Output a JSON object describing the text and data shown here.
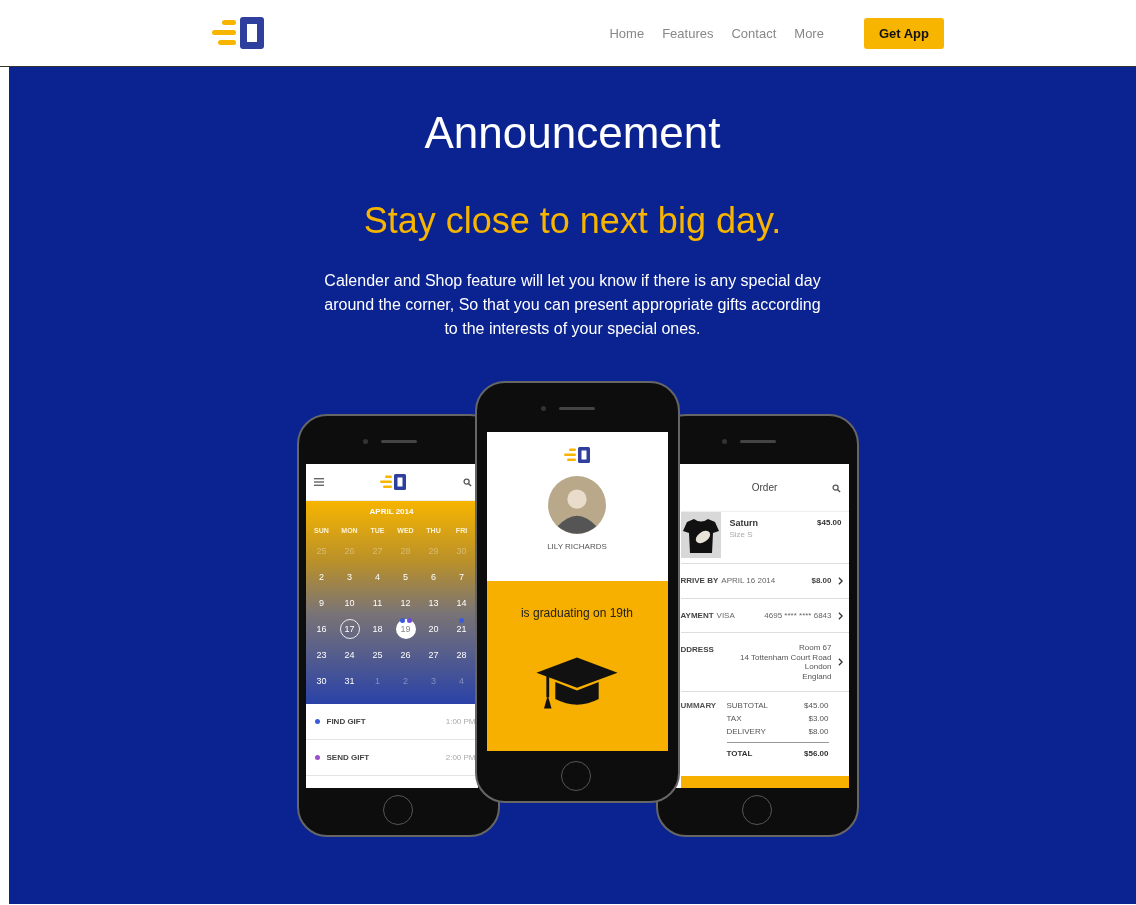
{
  "header": {
    "nav": [
      "Home",
      "Features",
      "Contact",
      "More"
    ],
    "cta": "Get App"
  },
  "hero": {
    "title": "Announcement",
    "subtitle": "Stay close to next big day.",
    "body": "Calender and Shop feature will let you know if there is any special day around the corner, So that you can present appropriate gifts according to the interests of your special ones."
  },
  "calendar_phone": {
    "month": "APRIL 2014",
    "weekdays": [
      "SUN",
      "MON",
      "TUE",
      "WED",
      "THU",
      "FRI"
    ],
    "days": [
      {
        "label": "25",
        "kind": "faded"
      },
      {
        "label": "26",
        "kind": "faded"
      },
      {
        "label": "27",
        "kind": "faded"
      },
      {
        "label": "28",
        "kind": "faded"
      },
      {
        "label": "29",
        "kind": "faded"
      },
      {
        "label": "30",
        "kind": "faded"
      },
      {
        "label": "2",
        "kind": "plain"
      },
      {
        "label": "3",
        "kind": "plain"
      },
      {
        "label": "4",
        "kind": "plain"
      },
      {
        "label": "5",
        "kind": "plain"
      },
      {
        "label": "6",
        "kind": "plain"
      },
      {
        "label": "7",
        "kind": "plain"
      },
      {
        "label": "9",
        "kind": "plain"
      },
      {
        "label": "10",
        "kind": "plain"
      },
      {
        "label": "11",
        "kind": "plain"
      },
      {
        "label": "12",
        "kind": "plain"
      },
      {
        "label": "13",
        "kind": "plain"
      },
      {
        "label": "14",
        "kind": "plain"
      },
      {
        "label": "16",
        "kind": "plain"
      },
      {
        "label": "17",
        "kind": "ring"
      },
      {
        "label": "18",
        "kind": "plain"
      },
      {
        "label": "19",
        "kind": "selected",
        "events": [
          {
            "color": "#3b5bdb"
          },
          {
            "color": "#7048e8"
          }
        ]
      },
      {
        "label": "20",
        "kind": "plain"
      },
      {
        "label": "21",
        "kind": "plain",
        "events": [
          {
            "color": "#3b5bdb"
          }
        ]
      },
      {
        "label": "23",
        "kind": "plain"
      },
      {
        "label": "24",
        "kind": "plain"
      },
      {
        "label": "25",
        "kind": "plain"
      },
      {
        "label": "26",
        "kind": "plain"
      },
      {
        "label": "27",
        "kind": "plain"
      },
      {
        "label": "28",
        "kind": "plain"
      },
      {
        "label": "30",
        "kind": "plain"
      },
      {
        "label": "31",
        "kind": "plain"
      },
      {
        "label": "1",
        "kind": "faded"
      },
      {
        "label": "2",
        "kind": "faded"
      },
      {
        "label": "3",
        "kind": "faded"
      },
      {
        "label": "4",
        "kind": "faded"
      }
    ],
    "events": [
      {
        "title": "FIND GIFT",
        "time": "1:00 PM",
        "color": "#3b5bdb"
      },
      {
        "title": "SEND GIFT",
        "time": "2:00 PM",
        "color": "#9c4dcc"
      }
    ]
  },
  "profile_phone": {
    "name": "LILY RICHARDS",
    "message": "is graduating on 19th"
  },
  "order_phone": {
    "title": "Order",
    "item": {
      "name": "Saturn",
      "size": "Size S",
      "price": "$45.00"
    },
    "rows": [
      {
        "kind": "inline",
        "label": "RRIVE BY",
        "detail": "APRIL 16 2014",
        "value": "$8.00"
      },
      {
        "kind": "inline",
        "label": "AYMENT",
        "detail": "VISA",
        "value": "4695 **** **** 6843"
      },
      {
        "kind": "address",
        "label": "DDRESS",
        "lines": [
          "Room 67",
          "14 Tottenham Court Road",
          "London",
          "England"
        ]
      }
    ],
    "summary": {
      "label": "UMMARY",
      "lines": [
        {
          "label": "SUBTOTAL",
          "value": "$45.00"
        },
        {
          "label": "TAX",
          "value": "$3.00"
        },
        {
          "label": "DELIVERY",
          "value": "$8.00"
        }
      ],
      "total": {
        "label": "TOTAL",
        "value": "$56.00"
      }
    }
  }
}
